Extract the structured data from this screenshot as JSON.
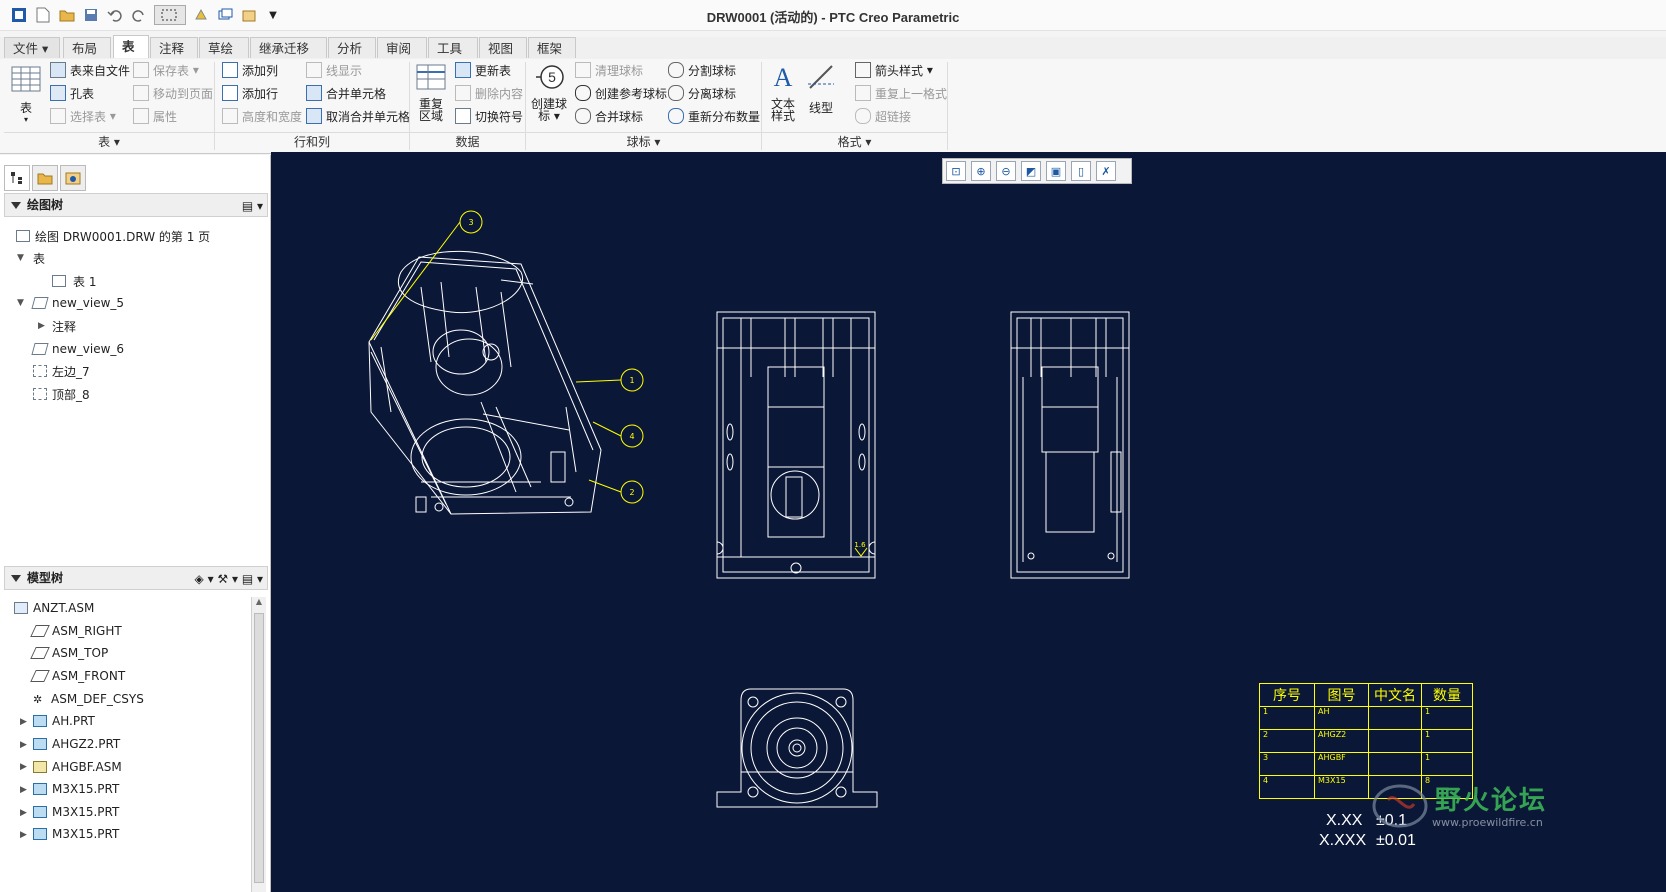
{
  "window": {
    "title": "DRW0001 (活动的) - PTC Creo Parametric"
  },
  "tabs": [
    {
      "label": "文件 ▾"
    },
    {
      "label": "布局"
    },
    {
      "label": "表"
    },
    {
      "label": "注释"
    },
    {
      "label": "草绘"
    },
    {
      "label": "继承迁移"
    },
    {
      "label": "分析"
    },
    {
      "label": "审阅"
    },
    {
      "label": "工具"
    },
    {
      "label": "视图"
    },
    {
      "label": "框架"
    }
  ],
  "ribbon": {
    "table_group": {
      "big_table": "表",
      "table_from_file": "表来自文件",
      "save_table": "保存表",
      "hole_table": "孔表",
      "move_to_page": "移动到页面",
      "select_table": "选择表",
      "properties": "属性",
      "label": "表 ▾"
    },
    "rows_cols": {
      "add_col": "添加列",
      "line_display": "线显示",
      "add_row": "添加行",
      "merge_cells": "合并单元格",
      "height_width": "高度和宽度",
      "unmerge_cells": "取消合并单元格",
      "label": "行和列"
    },
    "data": {
      "repeat_region_1": "重复",
      "repeat_region_2": "区域",
      "update_table": "更新表",
      "delete_content": "删除内容",
      "switch_symbol": "切换符号",
      "label": "数据"
    },
    "balloons": {
      "create_1": "创建球",
      "create_2": "标 ▾",
      "clean": "清理球标",
      "split": "分割球标",
      "create_ref": "创建参考球标",
      "detach": "分离球标",
      "merge": "合并球标",
      "redistribute": "重新分布数量",
      "label": "球标 ▾"
    },
    "format": {
      "text_style_1": "文本",
      "text_style_2": "样式",
      "line_style": "线型",
      "arrow_style": "箭头样式",
      "repeat_format": "重复上一格式",
      "hyperlink": "超链接",
      "label": "格式 ▾"
    }
  },
  "drawing_tree": {
    "header": "绘图树",
    "items": [
      {
        "label": "绘图 DRW0001.DRW 的第 1 页"
      },
      {
        "label": "表"
      },
      {
        "label": "表 1"
      },
      {
        "label": "new_view_5"
      },
      {
        "label": "注释"
      },
      {
        "label": "new_view_6"
      },
      {
        "label": "左边_7"
      },
      {
        "label": "顶部_8"
      }
    ]
  },
  "model_tree": {
    "header": "模型树",
    "items": [
      {
        "label": "ANZT.ASM"
      },
      {
        "label": "ASM_RIGHT"
      },
      {
        "label": "ASM_TOP"
      },
      {
        "label": "ASM_FRONT"
      },
      {
        "label": "ASM_DEF_CSYS"
      },
      {
        "label": "AH.PRT"
      },
      {
        "label": "AHGZ2.PRT"
      },
      {
        "label": "AHGBF.ASM"
      },
      {
        "label": "M3X15.PRT"
      },
      {
        "label": "M3X15.PRT"
      },
      {
        "label": "M3X15.PRT"
      }
    ]
  },
  "drawing": {
    "balloons": [
      "3",
      "1",
      "4",
      "2"
    ],
    "surface_mark": "1.6",
    "bom": {
      "headers": [
        "序号",
        "图号",
        "中文名",
        "数量"
      ],
      "rows": [
        [
          "1",
          "AH",
          "",
          "1"
        ],
        [
          "2",
          "AHGZ2",
          "",
          "1"
        ],
        [
          "3",
          "AHGBF",
          "",
          "1"
        ],
        [
          "4",
          "M3X15",
          "",
          "8"
        ]
      ]
    },
    "tolerance": {
      "xx": "X.XX",
      "xx_val": "±0.1",
      "xxx": "X.XXX",
      "xxx_val": "±0.01"
    },
    "watermark": {
      "text": "野火论坛",
      "url": "www.proewildfire.cn"
    }
  },
  "colors": {
    "canvas": "#0b1736",
    "lines": "#ffffff",
    "annotation": "#ffff00"
  }
}
